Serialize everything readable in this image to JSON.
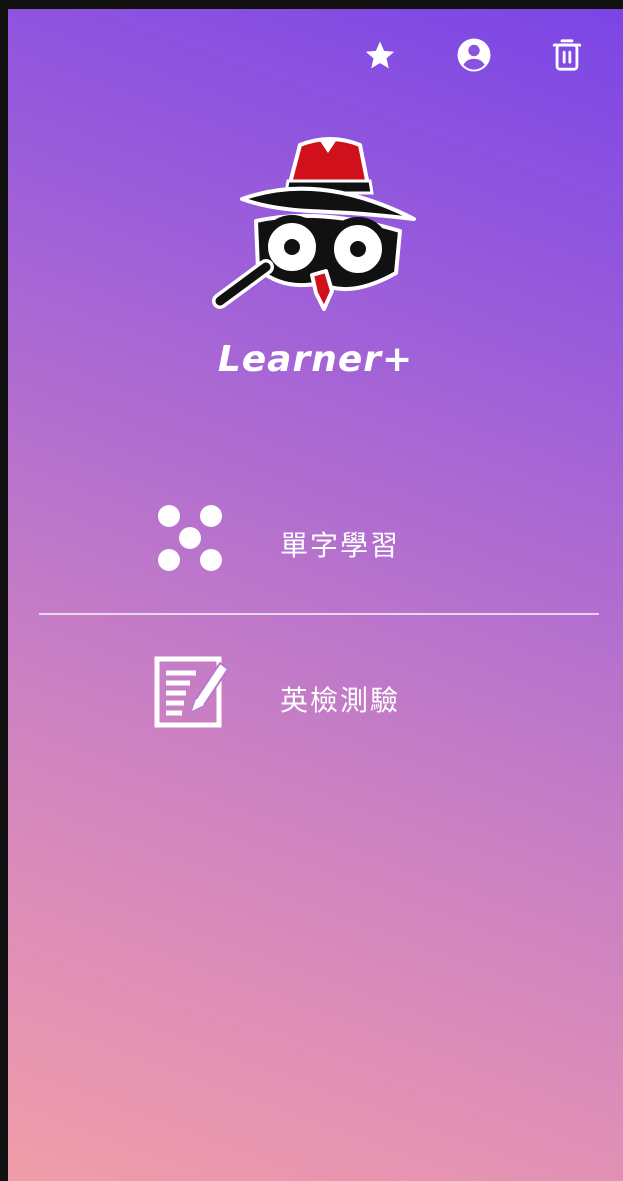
{
  "app": {
    "title": "Learner+"
  },
  "topbar": {
    "icons": [
      "star-icon",
      "account-circle-icon",
      "trash-icon"
    ]
  },
  "menu": {
    "items": [
      {
        "label": "單字學習",
        "icon": "dots-pattern-icon"
      },
      {
        "label": "英檢測驗",
        "icon": "document-pencil-icon"
      }
    ]
  },
  "colors": {
    "gradient_top": "#7b45e6",
    "gradient_mid": "#c47cc6",
    "gradient_bottom": "#f09da8",
    "hat_red": "#d0101a",
    "text": "#ffffff"
  }
}
